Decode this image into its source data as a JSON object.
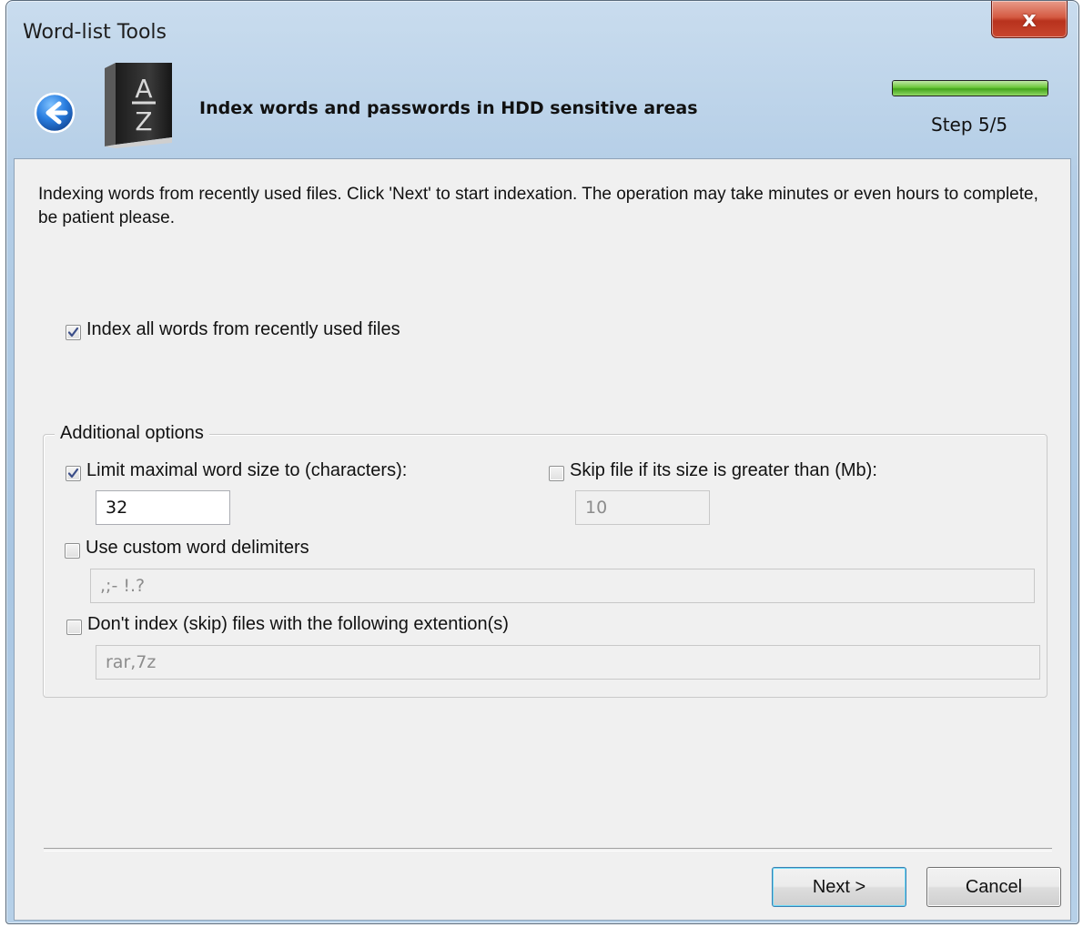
{
  "window": {
    "title": "Word-list Tools",
    "close_label": "x"
  },
  "header": {
    "title": "Index words and passwords in HDD sensitive areas",
    "step": "Step 5/5",
    "progress": 1.0,
    "book_letters": [
      "A",
      "Z"
    ]
  },
  "intro_text": "Indexing words from recently used files. Click 'Next' to start indexation. The operation may take minutes or even hours to complete, be patient please.",
  "index_all": {
    "label": "Index all words from recently used files",
    "checked": true
  },
  "additional_options": {
    "legend": "Additional options",
    "limit_word_size": {
      "label": "Limit maximal word size to (characters):",
      "checked": true,
      "value": "32"
    },
    "skip_large_files": {
      "label": "Skip file if its size is greater than (Mb):",
      "checked": false,
      "value": "10"
    },
    "custom_delimiters": {
      "label": "Use custom word delimiters",
      "checked": false,
      "value": ",;- !.?"
    },
    "skip_extensions": {
      "label": "Don't index (skip) files with the following extention(s)",
      "checked": false,
      "value": "rar,7z"
    }
  },
  "buttons": {
    "next": "Next >",
    "cancel": "Cancel"
  },
  "colors": {
    "progress_green": "#44a51c",
    "back_arrow_blue": "#1f6fd1",
    "close_red": "#c9462e"
  },
  "icons": [
    "back-arrow-icon",
    "book-icon",
    "close-icon",
    "checkmark-icon"
  ]
}
